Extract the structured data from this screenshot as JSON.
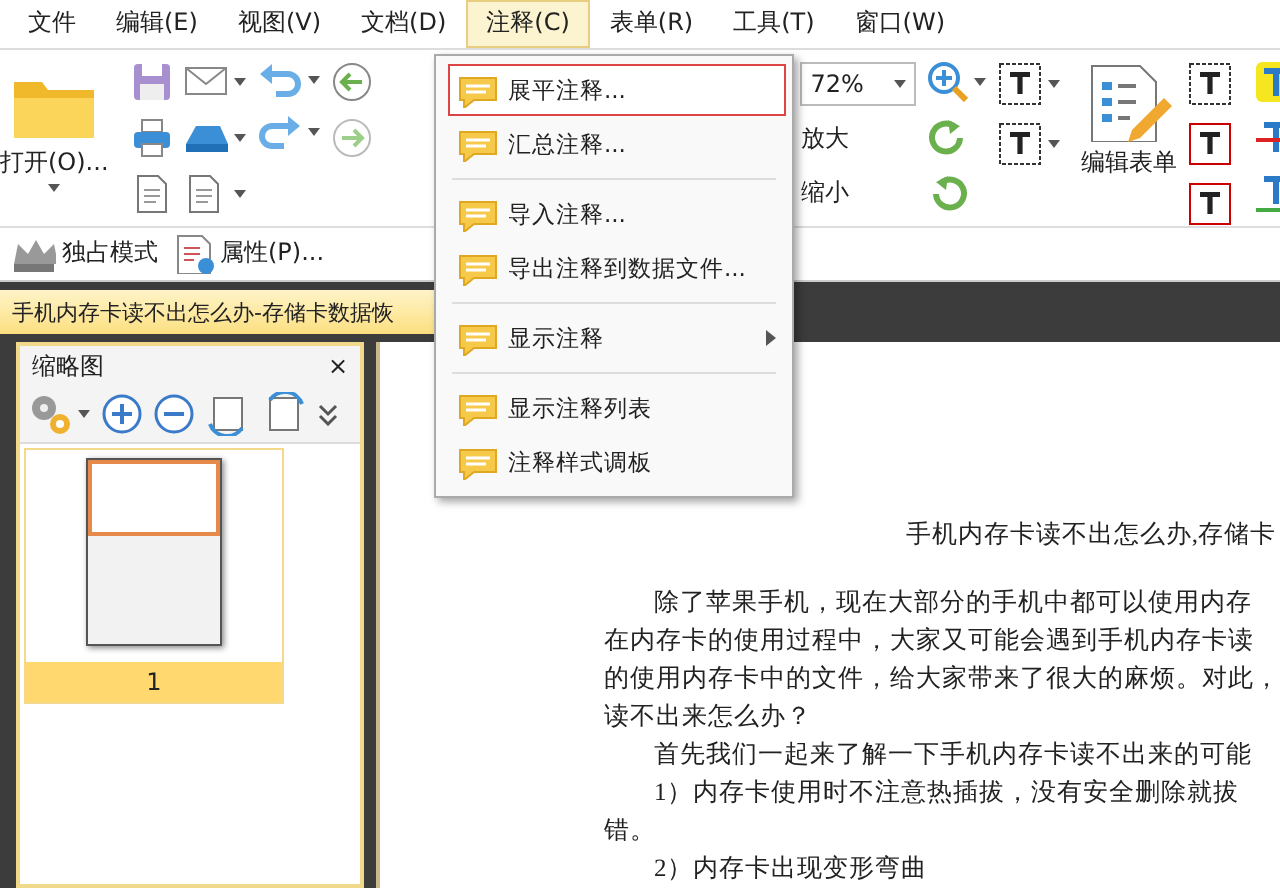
{
  "menu_bar": [
    {
      "label": "文件",
      "selected": false
    },
    {
      "label": "编辑(E)",
      "selected": false
    },
    {
      "label": "视图(V)",
      "selected": false
    },
    {
      "label": "文档(D)",
      "selected": false
    },
    {
      "label": "注释(C)",
      "selected": true
    },
    {
      "label": "表单(R)",
      "selected": false
    },
    {
      "label": "工具(T)",
      "selected": false
    },
    {
      "label": "窗口(W)",
      "selected": false
    }
  ],
  "toolbar": {
    "open_button": "打开(O)...",
    "zoom_value": "72%",
    "zoom_in": "放大",
    "zoom_out": "缩小",
    "edit_form_button": "编辑表单",
    "exclusive_mode": "独占模式",
    "properties": "属性(P)..."
  },
  "document_tab": {
    "title": "手机内存卡读不出怎么办-存储卡数据恢"
  },
  "dropdown": {
    "items": [
      {
        "kind": "item",
        "label": "展平注释...",
        "selected": true,
        "submenu": false
      },
      {
        "kind": "item",
        "label": "汇总注释...",
        "selected": false,
        "submenu": false
      },
      {
        "kind": "separator"
      },
      {
        "kind": "item",
        "label": "导入注释...",
        "selected": false,
        "submenu": false
      },
      {
        "kind": "item",
        "label": "导出注释到数据文件...",
        "selected": false,
        "submenu": false
      },
      {
        "kind": "separator"
      },
      {
        "kind": "item",
        "label": "显示注释",
        "selected": false,
        "submenu": true
      },
      {
        "kind": "separator"
      },
      {
        "kind": "item",
        "label": "显示注释列表",
        "selected": false,
        "submenu": false
      },
      {
        "kind": "item",
        "label": "注释样式调板",
        "selected": false,
        "submenu": false
      }
    ]
  },
  "thumbnail_panel": {
    "title": "缩略图",
    "close": "×",
    "pages": [
      {
        "label": "1",
        "selected": true
      }
    ]
  },
  "document": {
    "title": "手机内存卡读不出怎么办,存储卡",
    "lines": [
      {
        "text": "除了苹果手机，现在大部分的手机中都可以使用内存",
        "indent": true
      },
      {
        "text": "在内存卡的使用过程中，大家又可能会遇到手机内存卡读",
        "indent": false
      },
      {
        "text": "的使用内存卡中的文件，给大家带来了很大的麻烦。对此，",
        "indent": false
      },
      {
        "text": "读不出来怎么办？",
        "indent": false
      },
      {
        "text": "首先我们一起来了解一下手机内存卡读不出来的可能",
        "indent": true
      },
      {
        "text": "1）内存卡使用时不注意热插拔，没有安全删除就拔",
        "indent": true
      },
      {
        "text": "错。",
        "indent": false
      },
      {
        "text": "2）内存卡出现变形弯曲",
        "indent": true
      }
    ]
  }
}
